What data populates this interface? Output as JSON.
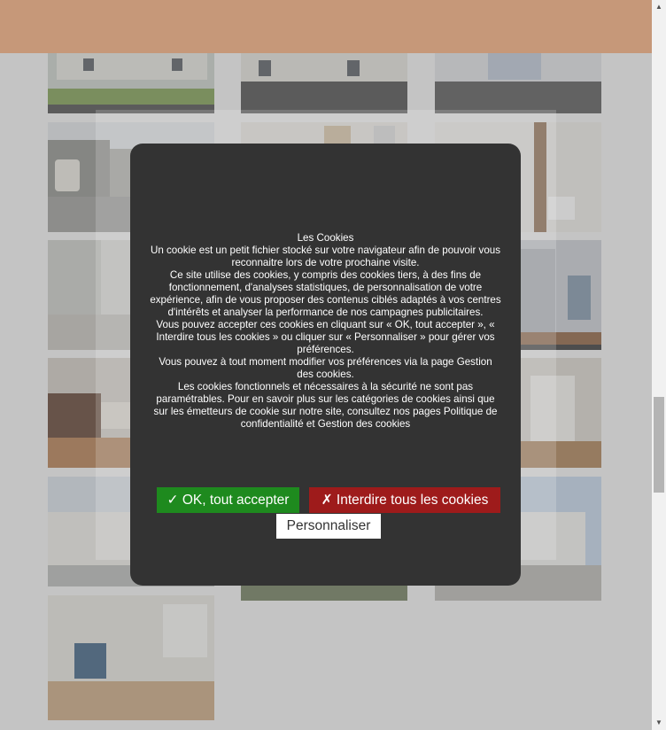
{
  "cookie_banner": {
    "paragraphs": [
      "Les Cookies",
      "Un cookie est un petit fichier stocké sur votre navigateur afin de pouvoir vous reconnaitre lors de votre prochaine visite.",
      "Ce site utilise des cookies, y compris des cookies tiers, à des fins de fonctionnement, d'analyses statistiques, de personnalisation de votre expérience, afin de vous proposer des contenus ciblés adaptés à vos centres d'intérêts et analyser la performance de nos campagnes publicitaires.",
      "Vous pouvez accepter ces cookies en cliquant sur « OK, tout accepter », «  Interdire tous les cookies  » ou cliquer sur « Personnaliser » pour gérer vos préférences.",
      "Vous pouvez à tout moment modifier vos préférences via la page Gestion des cookies.",
      "Les cookies fonctionnels et nécessaires à la sécurité ne sont pas paramétrables. Pour en savoir plus sur les catégories de cookies ainsi que sur les émetteurs de cookie sur notre site, consultez nos pages Politique de confidentialité et Gestion des cookies"
    ],
    "accept_label": "✓ OK, tout accepter",
    "deny_label": "✗ Interdire tous les cookies",
    "customize_label": "Personnaliser"
  },
  "scrollbar": {
    "up_arrow": "▲",
    "down_arrow": "▼"
  },
  "colors": {
    "header": "#f6ab79",
    "modal_bg": "#333333",
    "accept": "#1e8a1e",
    "deny": "#9e1b1b"
  }
}
